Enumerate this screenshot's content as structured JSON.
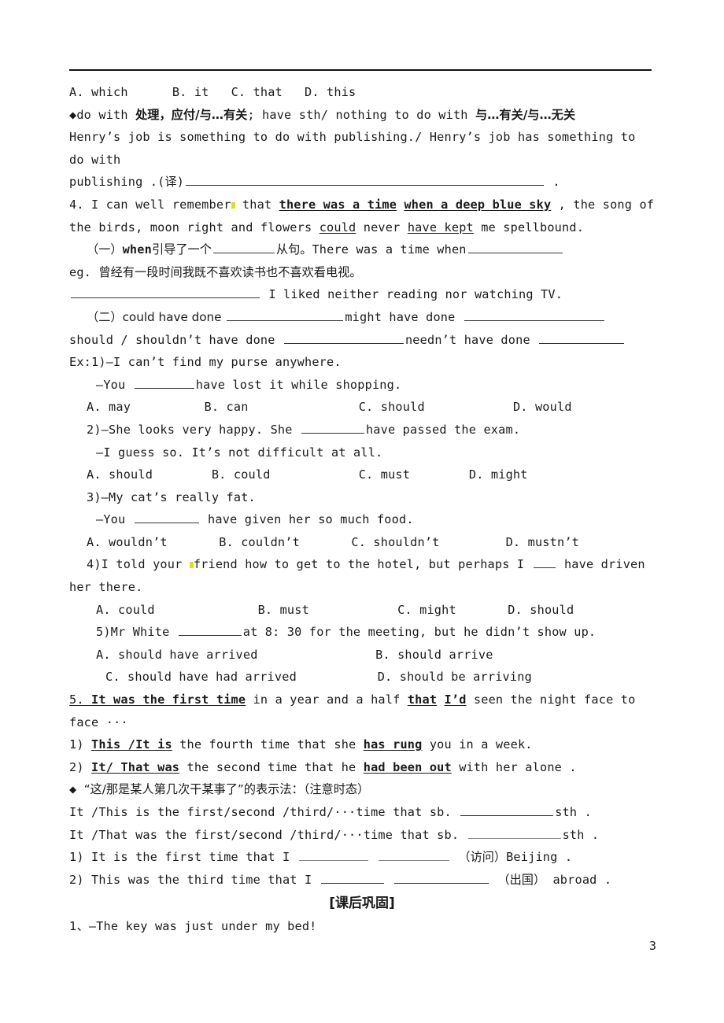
{
  "document": {
    "page_number": "3",
    "header_rule": true
  },
  "lines": {
    "l1_options": {
      "a": "A. which",
      "b": "B. it",
      "c": "C. that",
      "d": "D. this"
    },
    "l2_dowith": {
      "bullet": "◆",
      "lead": "do with ",
      "cjk1": "处理，应付/与…有关",
      "mid": "; have sth/ nothing to do with ",
      "cjk2": "与…有关/与…无关"
    },
    "l3_henry": "Henry’s job is something to do with publishing./ Henry’s job has something to",
    "l4_dowith": "do with",
    "l5_publishing": {
      "pre": "publishing .(",
      "cjk": "译",
      "post": ")",
      "tail": "."
    },
    "l6_item4": {
      "num": "4. ",
      "p1": "I can well remember",
      "highlight": true,
      "p2": " that ",
      "u1": "there was a time",
      "sp": " ",
      "u2": "when a deep blue sky",
      "p3": " , the song of"
    },
    "l7_item4b": {
      "p1": "the birds, moon right and flowers ",
      "u1": "could",
      "p2": " never ",
      "u2": "have kept",
      "p3": " me spellbound."
    },
    "l8_when": {
      "p1": "（一）",
      "when": "when",
      "cjk1": "引导了一个",
      "cjk2": "从句。",
      "p2": "There was a time when"
    },
    "l9_eg": {
      "p1": "eg. ",
      "cjk": "曾经有一段时间我既不喜欢读书也不喜欢看电视。"
    },
    "l10_blank_sentence": "I liked neither reading nor watching TV.",
    "l11_could": {
      "p1": "（二）could have done ",
      "p2": "might have done "
    },
    "l12_should": {
      "p1": "should / shouldn’t have done ",
      "p2": "needn’t have done "
    },
    "l13_ex1": "Ex:1)—I can’t find my purse anywhere.",
    "l14_you": {
      "p1": "—You ",
      "p2": "have lost it while shopping."
    },
    "l15_options": {
      "a": "A. may",
      "b": "B. can",
      "c": "C. should",
      "d": "D. would"
    },
    "l16_q2": {
      "p1": "2)—She looks very happy. She ",
      "p2": "have passed the exam."
    },
    "l17_guess": "—I guess so. It’s not difficult at all.",
    "l18_options": {
      "a": "A. should",
      "b": "B. could",
      "c": "C. must",
      "d": "D. might"
    },
    "l19_q3": "3)—My cat’s really fat.",
    "l20_you": {
      "p1": "—You ",
      "p2": " have given her so much food."
    },
    "l21_options": {
      "a": "A. wouldn’t",
      "b": "B. couldn’t",
      "c": "C. shouldn’t",
      "d": "D. mustn’t"
    },
    "l22_q4": {
      "p1": "4)I told your ",
      "highlight": true,
      "p2": "friend how to get to the hotel, but perhaps I ",
      "p3": " have driven"
    },
    "l23_her": "her there.",
    "l24_options": {
      "a": "A. could",
      "b": "B. must",
      "c": "C. might",
      "d": "D. should"
    },
    "l25_q5": {
      "p1": "5)Mr White ",
      "p2": "at 8: 30 for the meeting, but he didn’t show up."
    },
    "l26_options_ab": {
      "a": "A. should have arrived",
      "b": "B. should arrive"
    },
    "l27_options_cd": {
      "c": "C. should have had arrived",
      "d": "D. should be arriving"
    },
    "l28_item5": {
      "num": "5. ",
      "u1": "It was the first time",
      "p1": " in a year and a half ",
      "u2": "that",
      "p2": " ",
      "u3": "I’d",
      "p3": " seen the night face to"
    },
    "l29_face": "face ···",
    "l30_sub1": {
      "num": "1) ",
      "u1": "This /It is",
      "p1": " the fourth time that she ",
      "u2": "has rung",
      "p2": " you in a week."
    },
    "l31_sub2": {
      "num": "2) ",
      "u1": "It/ That was",
      "p1": " the second time that he ",
      "u2": "had been out",
      "p2": " with her alone ."
    },
    "l32_diamond": {
      "bullet": "◆ ",
      "cjk": "“这/那是某人第几次干某事了”的表示法：（注意时态）"
    },
    "l33_pattern1": {
      "p1": "It /This is the first/second /third/···time that sb. ",
      "p2": "sth ."
    },
    "l34_pattern2": {
      "p1": "It /That was the first/second /third/···time that sb. ",
      "p2": "sth ."
    },
    "l35_ex1": {
      "num": "1) ",
      "p1": "It is the first time that I ",
      "cjk": "（访问）",
      "p2": "Beijing ."
    },
    "l36_ex2": {
      "num": "2) ",
      "p1": "This was the third time that I ",
      "cjk": "（出国）",
      "p2": " abroad ."
    },
    "l37_section_title": "[课后巩固]",
    "l38_q1": {
      "p1": "1、",
      "p2": "—The key was just under my bed!"
    }
  }
}
